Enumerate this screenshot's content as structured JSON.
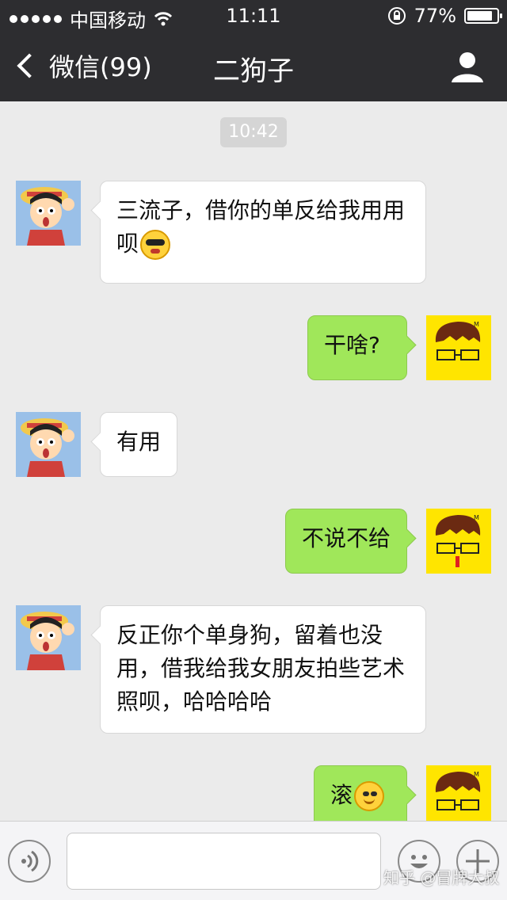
{
  "status_bar": {
    "carrier": "中国移动",
    "time": "11:11",
    "battery_percent": "77%",
    "icons": [
      "signal-dots-icon",
      "wifi-icon",
      "rotation-lock-icon",
      "battery-icon"
    ]
  },
  "nav": {
    "back_label": "微信(99)",
    "title": "二狗子",
    "profile_icon": "person-icon"
  },
  "chat": {
    "timestamp": "10:42",
    "messages": [
      {
        "sender": "other",
        "text": "三流子，借你的单反给我用用呗",
        "emoji": "sunglasses-face-emoji"
      },
      {
        "sender": "self",
        "text": "干啥?"
      },
      {
        "sender": "other",
        "text": "有用"
      },
      {
        "sender": "self",
        "text": "不说不给"
      },
      {
        "sender": "other",
        "text": "反正你个单身狗，留着也没用，借我给我女朋友拍些艺术照呗，哈哈哈哈"
      },
      {
        "sender": "self",
        "text": "滚",
        "emoji": "smiling-face-emoji"
      }
    ]
  },
  "input_bar": {
    "text_value": "",
    "icons": [
      "voice-icon",
      "emoji-icon",
      "plus-icon"
    ]
  },
  "watermark": "知乎 @冒牌大叔",
  "colors": {
    "nav_bg": "#2d2d30",
    "chat_bg": "#ebebeb",
    "outgoing_bubble": "#a0e75a",
    "incoming_bubble": "#ffffff"
  }
}
